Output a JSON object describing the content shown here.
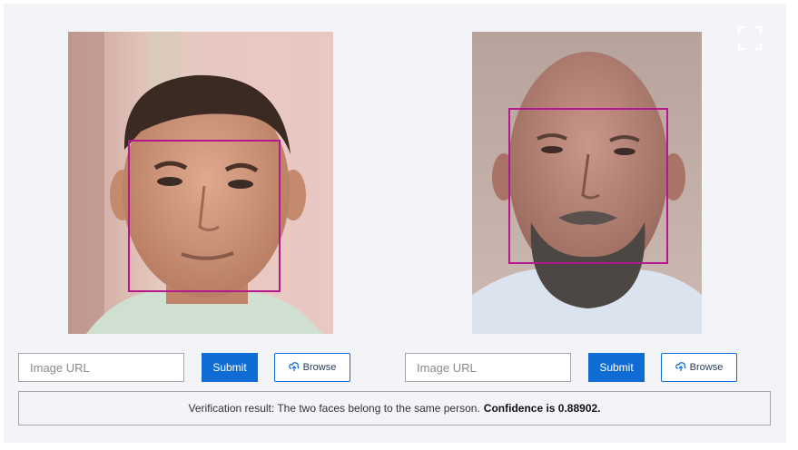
{
  "left": {
    "url_placeholder": "Image URL",
    "submit_label": "Submit",
    "browse_label": "Browse"
  },
  "right": {
    "url_placeholder": "Image URL",
    "submit_label": "Submit",
    "browse_label": "Browse"
  },
  "result": {
    "text": "Verification result: The two faces belong to the same person.",
    "confidence": "Confidence is 0.88902."
  },
  "colors": {
    "accent": "#0f6cd4",
    "face_box": "#b5178f",
    "panel": "#f3f4f7"
  },
  "icons": {
    "fullscreen": "fullscreen-icon",
    "browse": "upload-icon"
  }
}
